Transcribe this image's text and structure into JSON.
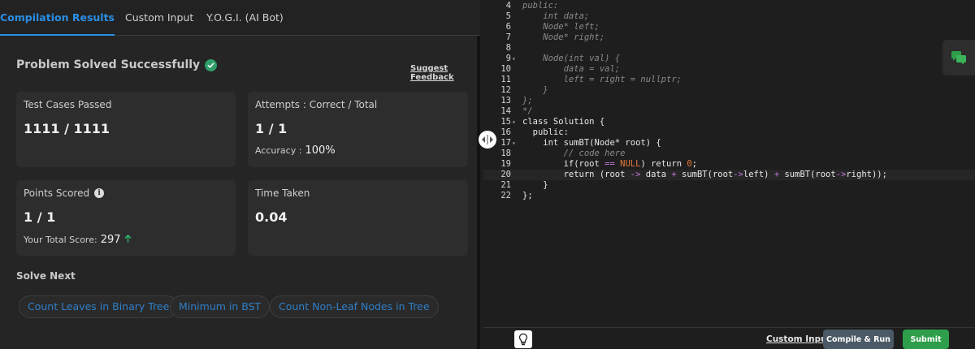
{
  "tabs": [
    {
      "label": "Compilation Results"
    },
    {
      "label": "Custom Input"
    },
    {
      "label": "Y.O.G.I. (AI Bot)"
    }
  ],
  "result": {
    "status": "Problem Solved Successfully",
    "feedback_link": "Suggest Feedback"
  },
  "cards": {
    "test_cases": {
      "label": "Test Cases Passed",
      "value": "1111 / 1111"
    },
    "attempts": {
      "label": "Attempts : Correct / Total",
      "value": "1 / 1",
      "accuracy_label": "Accuracy :",
      "accuracy_value": "100%"
    },
    "points": {
      "label": "Points Scored",
      "value": "1 / 1",
      "total_label": "Your Total Score:",
      "total_value": "297"
    },
    "time": {
      "label": "Time Taken",
      "value": "0.04"
    }
  },
  "solve_next": {
    "title": "Solve Next",
    "items": [
      "Count Leaves in Binary Tree",
      "Minimum in BST",
      "Count Non-Leaf Nodes in Tree"
    ]
  },
  "editor": {
    "line_numbers": [
      "4",
      "5",
      "6",
      "7",
      "8",
      "9",
      "10",
      "11",
      "12",
      "13",
      "14",
      "15",
      "16",
      "17",
      "18",
      "19",
      "20",
      "21",
      "22"
    ]
  },
  "bottom": {
    "custom_input": "Custom Input",
    "compile_run": "Compile & Run",
    "submit": "Submit"
  },
  "colors": {
    "accent_blue": "#2a8fe6",
    "success_green": "#2f9e6b",
    "submit_green": "#2f9e4a",
    "chip_text": "#2f7fc8"
  }
}
